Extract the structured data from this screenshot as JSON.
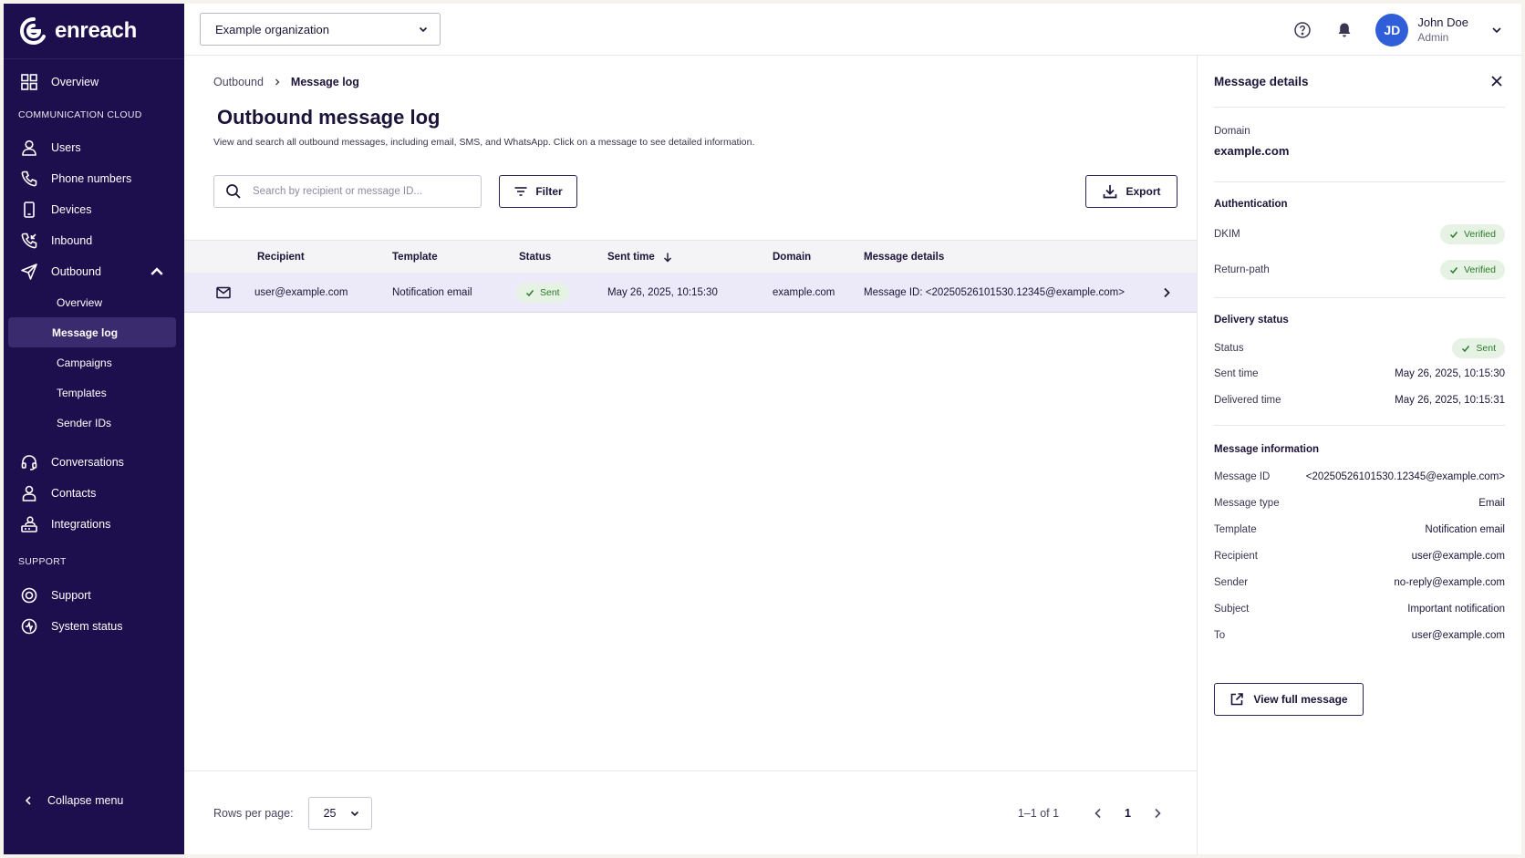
{
  "brand": {
    "name": "enreach"
  },
  "sidebar": {
    "overview": "Overview",
    "section_comm": "COMMUNICATION CLOUD",
    "users": "Users",
    "phone_numbers": "Phone numbers",
    "devices": "Devices",
    "inbound": "Inbound",
    "outbound": "Outbound",
    "outbound_sub": [
      "Overview",
      "Message log",
      "Campaigns",
      "Templates",
      "Sender IDs"
    ],
    "conversations": "Conversations",
    "contacts": "Contacts",
    "integrations": "Integrations",
    "section_support": "SUPPORT",
    "support": "Support",
    "system_status": "System status",
    "collapse": "Collapse menu"
  },
  "topbar": {
    "org": "Example organization",
    "user_name": "John Doe",
    "user_role": "Admin",
    "avatar_initials": "JD"
  },
  "breadcrumb": {
    "parent": "Outbound",
    "current": "Message log"
  },
  "page": {
    "title": "Outbound message log",
    "description": "View and search all outbound messages, including email, SMS, and WhatsApp. Click on a message to see detailed information."
  },
  "toolbar": {
    "search_placeholder": "Search by recipient or message ID...",
    "filter": "Filter",
    "export": "Export"
  },
  "table": {
    "headers": {
      "recipient": "Recipient",
      "template": "Template",
      "status": "Status",
      "sent_time": "Sent time",
      "domain": "Domain",
      "details": "Message details"
    },
    "rows": [
      {
        "recipient": "user@example.com",
        "template": "Notification email",
        "status": "Sent",
        "sent_time": "May 26, 2025, 10:15:30",
        "domain": "example.com",
        "details": "Message ID: <20250526101530.12345@example.com>"
      }
    ]
  },
  "pager": {
    "rows_label": "Rows per page:",
    "rows_value": "25",
    "range": "1–1 of 1",
    "page": "1"
  },
  "panel": {
    "title": "Message details",
    "domain_label": "Domain",
    "domain_value": "example.com",
    "auth_title": "Authentication",
    "dkim_label": "DKIM",
    "dkim_value": "Verified",
    "return_label": "Return-path",
    "return_value": "Verified",
    "delivery_title": "Delivery status",
    "status_label": "Status",
    "status_value": "Sent",
    "sent_label": "Sent time",
    "sent_value": "May 26, 2025, 10:15:30",
    "delivered_label": "Delivered time",
    "delivered_value": "May 26, 2025, 10:15:31",
    "info_title": "Message information",
    "info": [
      {
        "label": "Message ID",
        "value": "<20250526101530.12345@example.com>"
      },
      {
        "label": "Message type",
        "value": "Email"
      },
      {
        "label": "Template",
        "value": "Notification email"
      },
      {
        "label": "Recipient",
        "value": "user@example.com"
      },
      {
        "label": "Sender",
        "value": "no-reply@example.com"
      },
      {
        "label": "Subject",
        "value": "Important notification"
      },
      {
        "label": "To",
        "value": "user@example.com"
      }
    ],
    "view_full": "View full message"
  },
  "colors": {
    "sidebar_bg": "#1d0f4d",
    "accent": "#2f5ed8",
    "success": "#2b7a2a",
    "selected_row": "#ece9f8"
  }
}
